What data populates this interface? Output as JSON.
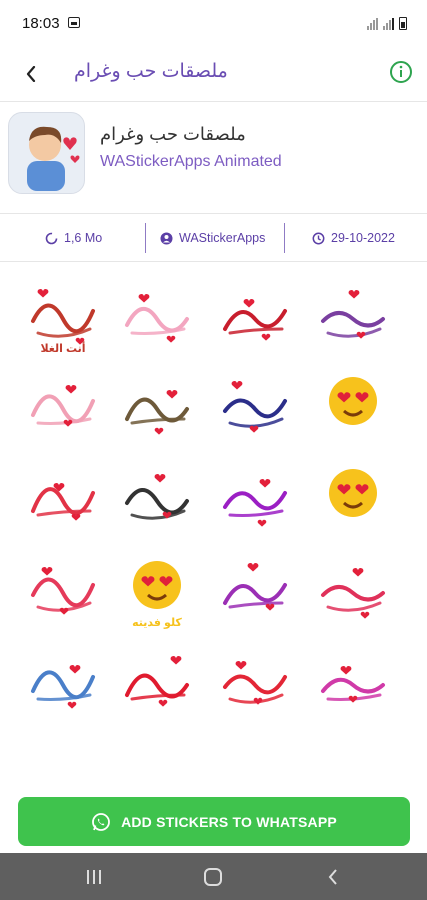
{
  "status_bar": {
    "time": "18:03"
  },
  "app_bar": {
    "title": "ملصقات حب وغرام"
  },
  "pack": {
    "name": "ملصقات حب وغرام",
    "publisher": "WAStickerApps Animated",
    "size": "1,6 Mo",
    "author": "WAStickerApps",
    "date": "29-10-2022"
  },
  "stickers": [
    {
      "id": "s01",
      "text": "أنت الغلا",
      "color": "#c0392b"
    },
    {
      "id": "s02",
      "text": "",
      "color": "#f3a6c0"
    },
    {
      "id": "s03",
      "text": "",
      "color": "#c81e2d"
    },
    {
      "id": "s04",
      "text": "",
      "color": "#7a3fa0"
    },
    {
      "id": "s05",
      "text": "",
      "color": "#f1a0b5"
    },
    {
      "id": "s06",
      "text": "",
      "color": "#6e5a3a"
    },
    {
      "id": "s07",
      "text": "",
      "color": "#2b2e8a"
    },
    {
      "id": "s08",
      "text": "",
      "color": "#d0192b"
    },
    {
      "id": "s09",
      "text": "",
      "color": "#e23346"
    },
    {
      "id": "s10",
      "text": "",
      "color": "#333333"
    },
    {
      "id": "s11",
      "text": "",
      "color": "#9b1fc4"
    },
    {
      "id": "s12",
      "text": "",
      "color": "#c0392b"
    },
    {
      "id": "s13",
      "text": "",
      "color": "#e53a5a"
    },
    {
      "id": "s14",
      "text": "كلو فديته",
      "color": "#f6c21c"
    },
    {
      "id": "s15",
      "text": "",
      "color": "#9b2fb5"
    },
    {
      "id": "s16",
      "text": "",
      "color": "#e0315a"
    },
    {
      "id": "s17",
      "text": "",
      "color": "#4a7fc9"
    },
    {
      "id": "s18",
      "text": "",
      "color": "#e01b2f"
    },
    {
      "id": "s19",
      "text": "",
      "color": "#e32636"
    },
    {
      "id": "s20",
      "text": "",
      "color": "#d03aa8"
    }
  ],
  "cta": {
    "label": "ADD STICKERS TO WHATSAPP"
  },
  "icons": {
    "back": "arrow-back-icon",
    "info": "info-icon",
    "size": "storage-icon",
    "author": "person-icon",
    "date": "clock-icon",
    "whatsapp": "whatsapp-icon"
  },
  "colors": {
    "accent": "#6a4db3",
    "cta": "#3fc34d",
    "nav": "#5f5f5f",
    "info": "#2ea44f"
  }
}
